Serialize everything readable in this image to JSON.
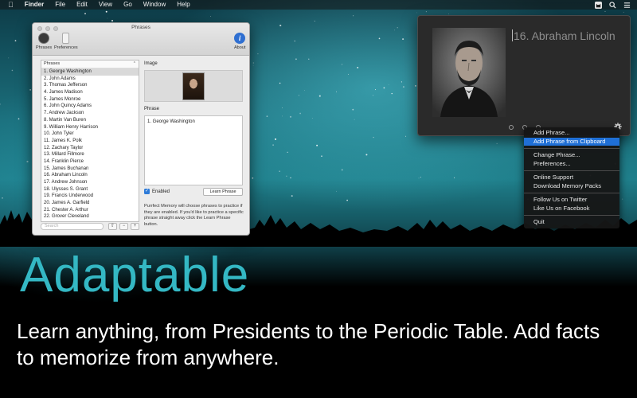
{
  "menubar": {
    "apple_icon": "apple-icon",
    "app": "Finder",
    "items": [
      "File",
      "Edit",
      "View",
      "Go",
      "Window",
      "Help"
    ],
    "right_icons": [
      "memory-cat-icon",
      "search-icon",
      "list-icon"
    ]
  },
  "phrases_window": {
    "title": "Phrases",
    "toolbar": {
      "phrases_label": "Phrases",
      "preferences_label": "Preferences",
      "about_label": "About"
    },
    "sidebar_header": "Phrases",
    "selected_index": 0,
    "phrases": [
      "1. George Washington",
      "2. John Adams",
      "3. Thomas Jefferson",
      "4. James Madison",
      "5. James Monroe",
      "6. John Quincy Adams",
      "7. Andrew Jackson",
      "8. Martin Van Buren",
      "9. William Henry Harrison",
      "10. John Tyler",
      "11. James K. Polk",
      "12. Zachary Taylor",
      "13. Millard Fillmore",
      "14. Franklin Pierce",
      "15. James Buchanan",
      "16. Abraham Lincoln",
      "17. Andrew Johnson",
      "18. Ulysses S. Grant",
      "19. Francis Underwood",
      "20. James A. Garfield",
      "21. Chester A. Arthur",
      "22. Grover Cleveland"
    ],
    "search_placeholder": "Search",
    "image_label": "Image",
    "phrase_label": "Phrase",
    "phrase_value": "1. George Washington",
    "enabled_label": "Enabled",
    "enabled": true,
    "learn_button": "Learn Phrase",
    "description": "Purrfect Memory will choose phrases to practice if they are enabled. If you'd like to practice a specific phrase straight away click the Learn Phrase button."
  },
  "popover": {
    "caption": "16. Abraham Lincoln",
    "page_dots": 3
  },
  "dropdown_menu": {
    "groups": [
      [
        "Add Phrase...",
        "Add Phrase from Clipboard"
      ],
      [
        "Change Phrase...",
        "Preferences..."
      ],
      [
        "Online Support",
        "Download Memory Packs"
      ],
      [
        "Follow Us on Twitter",
        "Like Us on Facebook"
      ],
      [
        "Quit"
      ]
    ],
    "highlighted": "Add Phrase from Clipboard"
  },
  "headline": "Adaptable",
  "tagline": "Learn anything, from Presidents to the Periodic Table. Add facts to memorize from anywhere.",
  "colors": {
    "accent": "#34b8c4",
    "menu_highlight": "#1f6fd6",
    "checkbox": "#2e7bd8"
  }
}
